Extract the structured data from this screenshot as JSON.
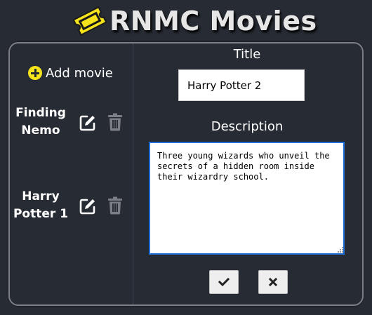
{
  "app": {
    "title": "RNMC Movies",
    "logo_icon": "ticket-icon",
    "accent_color": "#f5e31b",
    "background_color": "#272b33"
  },
  "sidebar": {
    "add_movie_label": "Add movie",
    "add_movie_icon": "plus-circle-icon",
    "movies": [
      {
        "title_line1": "Finding",
        "title_line2": "Nemo",
        "edit_icon": "edit-icon",
        "delete_icon": "trash-icon"
      },
      {
        "title_line1": "Harry",
        "title_line2": "Potter 1",
        "edit_icon": "edit-icon",
        "delete_icon": "trash-icon"
      }
    ]
  },
  "form": {
    "title_label": "Title",
    "title_value": "Harry Potter 2",
    "description_label": "Description",
    "description_value": "Three young wizards who unveil the secrets of a hidden room inside their wizardry school.",
    "confirm_icon": "check-icon",
    "cancel_icon": "x-icon"
  }
}
